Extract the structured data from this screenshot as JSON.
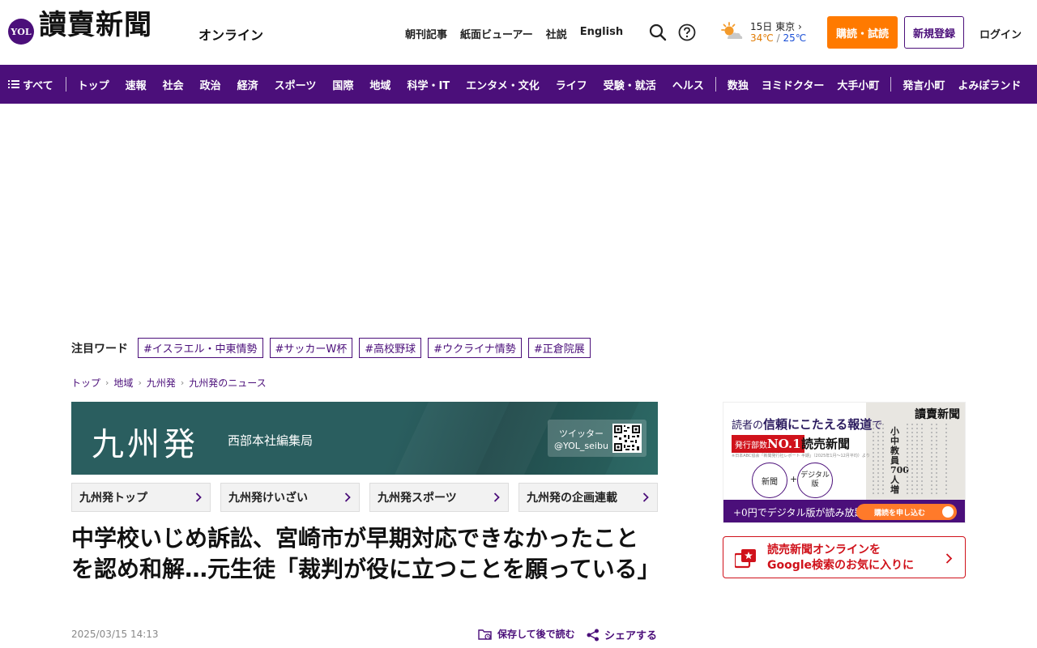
{
  "header": {
    "logo_badge": "YOL",
    "logo_text": "讀賣新聞",
    "logo_sub": "オンライン",
    "links": [
      "朝刊記事",
      "紙面ビューアー",
      "社説",
      "English"
    ],
    "search_icon": "search-icon",
    "help_icon": "help-icon",
    "weather": {
      "icon": "sun-cloud-icon",
      "date": "15日",
      "city": "東京",
      "high": "34℃",
      "separator": "/",
      "low": "25℃"
    },
    "subscribe_label": "購読・試読",
    "register_label": "新規登録",
    "login_label": "ログイン"
  },
  "nav": {
    "all_label": "すべて",
    "group1": [
      "トップ",
      "速報",
      "社会",
      "政治",
      "経済",
      "スポーツ",
      "国際",
      "地域",
      "科学・IT",
      "エンタメ・文化",
      "ライフ",
      "受験・就活",
      "ヘルス"
    ],
    "group2": [
      "数独",
      "ヨミドクター",
      "大手小町"
    ],
    "group3": [
      "発言小町",
      "よみぽランド"
    ]
  },
  "trending": {
    "label": "注目ワード",
    "tags": [
      "#イスラエル・中東情勢",
      "#サッカーW杯",
      "#高校野球",
      "#ウクライナ情勢",
      "#正倉院展"
    ]
  },
  "breadcrumb": [
    "トップ",
    "地域",
    "九州発",
    "九州発のニュース"
  ],
  "banner": {
    "title": "九州発",
    "subtitle": "西部本社編集局",
    "twitter_label": "ツイッター",
    "twitter_handle": "@YOL_seibu"
  },
  "subtabs": [
    "九州発トップ",
    "九州発けいざい",
    "九州発スポーツ",
    "九州発の企画連載"
  ],
  "article": {
    "title": "中学校いじめ訴訟、宮崎市が早期対応できなかったことを認め和解…元生徒「裁判が役に立つことを願っている」",
    "date": "2025/03/15 14:13",
    "save_label": "保存して後で読む",
    "share_label": "シェアする"
  },
  "side_ad": {
    "headline_pre": "読者の",
    "headline_em": "信頼にこたえる報道",
    "headline_post": "で",
    "badge_pre": "発行部数",
    "badge_em": "NO.1",
    "brand": "読売新聞",
    "note": "※日本ABC協会「新聞発行社レポート 半期」（2025年1月〜12月平均）より",
    "circle1": "新聞",
    "plus": "+",
    "circle2_line1": "デジタル",
    "circle2_line2": "版",
    "paper_title": "讀賣新聞",
    "paper_headline": "小中教員700人増",
    "bar_text": "+0円でデジタル版が読み放題!",
    "cta": "購読を申し込む"
  },
  "google_fav": {
    "line1": "読売新聞オンラインを",
    "line2": "Google検索のお気に入りに"
  },
  "colors": {
    "brand_purple": "#4b0f7a",
    "accent_orange": "#ff7a00",
    "red": "#d0121b",
    "banner_teal": "#2a5e5f"
  }
}
